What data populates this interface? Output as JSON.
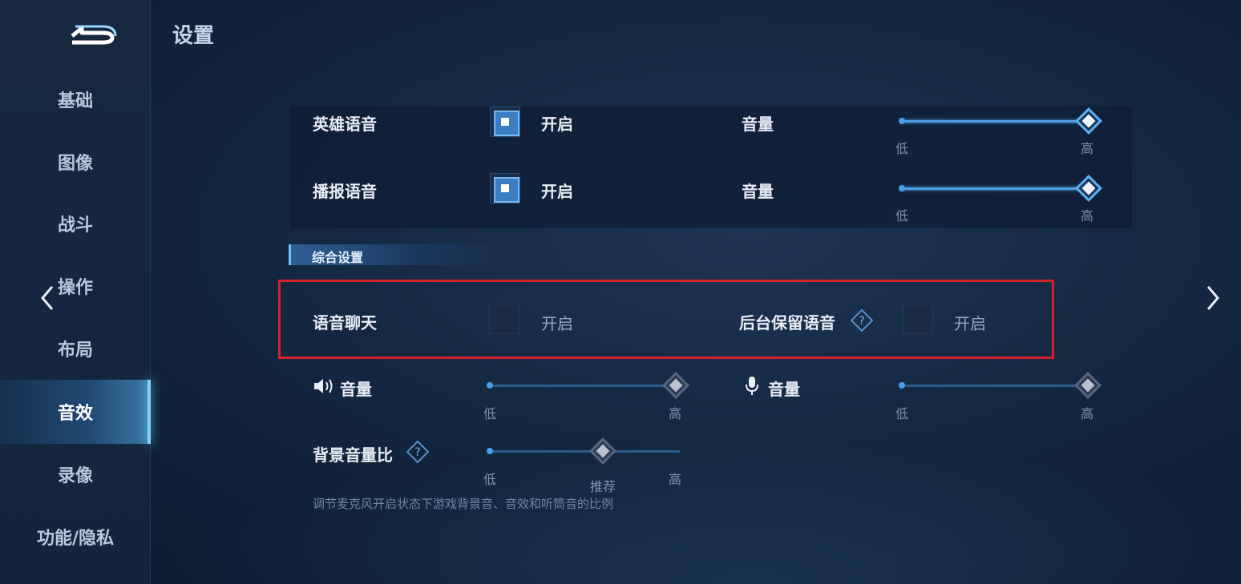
{
  "header": {
    "title": "设置"
  },
  "sidebar": {
    "items": [
      {
        "label": "基础"
      },
      {
        "label": "图像"
      },
      {
        "label": "战斗"
      },
      {
        "label": "操作"
      },
      {
        "label": "布局"
      },
      {
        "label": "音效",
        "active": true
      },
      {
        "label": "录像"
      },
      {
        "label": "功能/隐私"
      }
    ]
  },
  "hero_voice": {
    "label": "英雄语音",
    "checked": true,
    "check_label": "开启",
    "volume_label": "音量",
    "level": 1.0,
    "low": "低",
    "high": "高"
  },
  "broadcast_voice": {
    "label": "播报语音",
    "checked": true,
    "check_label": "开启",
    "volume_label": "音量",
    "level": 1.0,
    "low": "低",
    "high": "高"
  },
  "section": {
    "title": "综合设置"
  },
  "voice_chat": {
    "label": "语音聊天",
    "checked": false,
    "check_label": "开启"
  },
  "background_voice": {
    "label": "后台保留语音",
    "checked": false,
    "check_label": "开启"
  },
  "speaker_volume": {
    "label": "音量",
    "icon": "speaker-icon",
    "level": 1.0,
    "low": "低",
    "high": "高"
  },
  "mic_volume": {
    "label": "音量",
    "icon": "microphone-icon",
    "level": 1.0,
    "low": "低",
    "high": "高"
  },
  "bg_ratio": {
    "label": "背景音量比",
    "level": 0.5,
    "low": "低",
    "recommend": "推荐",
    "high": "高",
    "note": "调节麦克风开启状态下游戏背景音、音效和听筒音的比例"
  },
  "colors": {
    "accent": "#4d9ee8",
    "highlight": "#d3202c",
    "active_nav": "#7fd3ff"
  }
}
